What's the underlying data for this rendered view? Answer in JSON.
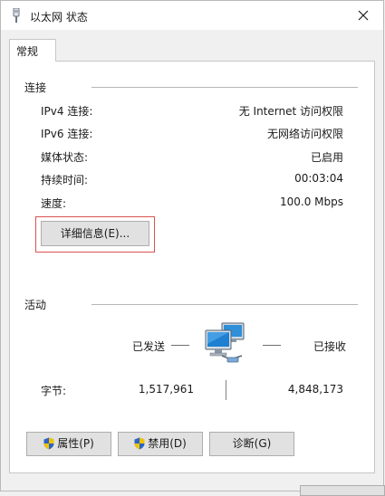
{
  "window": {
    "title": "以太网 状态"
  },
  "tabs": [
    {
      "label": "常规"
    }
  ],
  "connection": {
    "group_label": "连接",
    "rows": [
      {
        "label": "IPv4 连接:",
        "value": "无 Internet 访问权限"
      },
      {
        "label": "IPv6 连接:",
        "value": "无网络访问权限"
      },
      {
        "label": "媒体状态:",
        "value": "已启用"
      },
      {
        "label": "持续时间:",
        "value": "00:03:04"
      },
      {
        "label": "速度:",
        "value": "100.0 Mbps"
      }
    ],
    "details_button": "详细信息(E)..."
  },
  "activity": {
    "group_label": "活动",
    "sent_label": "已发送",
    "received_label": "已接收",
    "bytes_label": "字节:",
    "bytes_sent": "1,517,961",
    "bytes_received": "4,848,173"
  },
  "buttons": {
    "properties": "属性(P)",
    "disable": "禁用(D)",
    "diagnose": "诊断(G)"
  },
  "icons": {
    "title": "ethernet-plug-icon",
    "close": "close-icon",
    "network": "network-computers-icon",
    "shield": "uac-shield-icon"
  },
  "colors": {
    "highlight": "#d9534f",
    "shield_blue": "#2b64c4",
    "shield_yellow": "#f2c200"
  }
}
